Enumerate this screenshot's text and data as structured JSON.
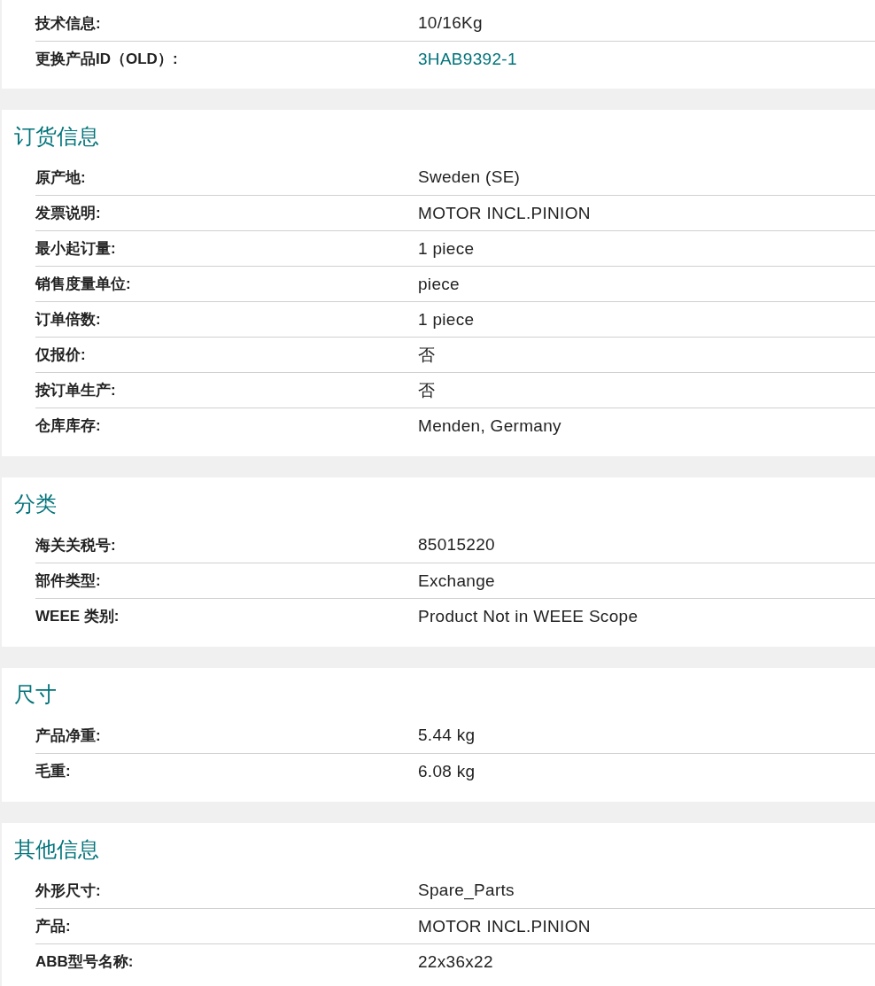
{
  "sections": [
    {
      "rows": [
        {
          "label": "技术信息:",
          "value": "10/16Kg"
        },
        {
          "label": "更换产品ID（OLD）:",
          "value": "3HAB9392-1",
          "kind": "link"
        }
      ]
    },
    {
      "title": "订货信息",
      "rows": [
        {
          "label": "原产地:",
          "value": "Sweden (SE)"
        },
        {
          "label": "发票说明:",
          "value": "MOTOR INCL.PINION"
        },
        {
          "label": "最小起订量:",
          "value": "1 piece"
        },
        {
          "label": "销售度量单位:",
          "value": "piece"
        },
        {
          "label": "订单倍数:",
          "value": "1 piece"
        },
        {
          "label": "仅报价:",
          "value": "否"
        },
        {
          "label": "按订单生产:",
          "value": "否"
        },
        {
          "label": "仓库库存:",
          "value": "Menden, Germany"
        }
      ]
    },
    {
      "title": "分类",
      "rows": [
        {
          "label": "海关关税号:",
          "value": "85015220"
        },
        {
          "label": "部件类型:",
          "value": "Exchange"
        },
        {
          "label": "WEEE 类别:",
          "value": "Product Not in WEEE Scope"
        }
      ]
    },
    {
      "title": "尺寸",
      "rows": [
        {
          "label": "产品净重:",
          "value": "5.44 kg"
        },
        {
          "label": "毛重:",
          "value": "6.08 kg"
        }
      ]
    },
    {
      "title": "其他信息",
      "rows": [
        {
          "label": "外形尺寸:",
          "value": "Spare_Parts"
        },
        {
          "label": "产品:",
          "value": "MOTOR INCL.PINION"
        },
        {
          "label": "ABB型号名称:",
          "value": "22x36x22"
        }
      ]
    }
  ]
}
